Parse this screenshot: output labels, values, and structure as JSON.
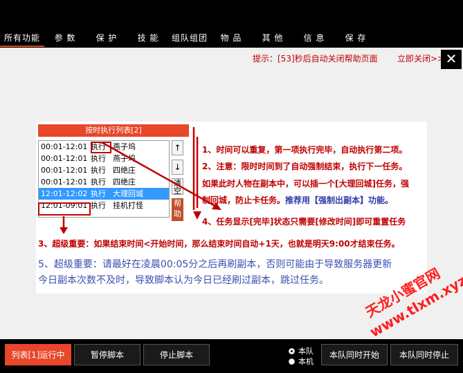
{
  "tabs": [
    "所有功能",
    "参 数",
    "保 护",
    "技 能",
    "组队组团",
    "物 品",
    "其 他",
    "信 息",
    "保 存"
  ],
  "notice": {
    "text": "提示：[53]秒后自动关闭帮助页面",
    "close_now": "立即关闭>>",
    "close_x": "✕"
  },
  "help": {
    "list_header": "按时执行列表[2]",
    "rows": [
      {
        "time": "00:01-12:01",
        "action": "执行",
        "target": "燕子坞"
      },
      {
        "time": "00:01-12:01",
        "action": "执行",
        "target": "燕子坞"
      },
      {
        "time": "00:01-12:01",
        "action": "执行",
        "target": "四绝庄"
      },
      {
        "time": "00:01-12:01",
        "action": "执行",
        "target": "四绝庄"
      },
      {
        "time": "12:01-12:02",
        "action": "执行",
        "target": "大理回城"
      },
      {
        "time": "12:01-09:01",
        "action": "执行",
        "target": "挂机打怪"
      }
    ],
    "btn_up": "↑",
    "btn_down": "↓",
    "btn_clear": "清空",
    "btn_help": "帮助",
    "note1": "1、时间可以重复，第一项执行完毕，自动执行第二项。",
    "note2": "2、注意：限时时间到了自动强制结束，执行下一任务。",
    "note3": "如果此时人物在副本中，可以插一个[大理回城]任务，强",
    "note3b_a": "制回城，防止卡任务。",
    "note3b_b": "推荐用【强制出副本】功能。",
    "note4": "4、任务显示[完毕]状态只需要[修改时间]即可重置任务",
    "note5": "3、超级重要：如果结束时间<开始时间，那么结束时间自动+1天，也就是明天9:00才结束任务。",
    "note6a": "5、超级重要：请最好在凌晨00:05分之后再刷副本，否则可能由于导致服务器更新",
    "note6b": "今日副本次数不及时，导致脚本认为今日已经刷过副本，跳过任务。",
    "watermark1": "天龙小蜜官网",
    "watermark2": "www.tlxm.xyz"
  },
  "bottom": {
    "status_btn": "列表[1]运行中",
    "pause_btn": "暂停脚本",
    "stop_btn": "停止脚本",
    "radio_team": "本队",
    "radio_self": "本机",
    "team_start": "本队同时开始",
    "team_stop": "本队同时停止"
  },
  "colors": {
    "accent": "#e8472a",
    "warning_text": "#c00000",
    "info_text": "#3a4fb0",
    "selection": "#3399ff"
  }
}
